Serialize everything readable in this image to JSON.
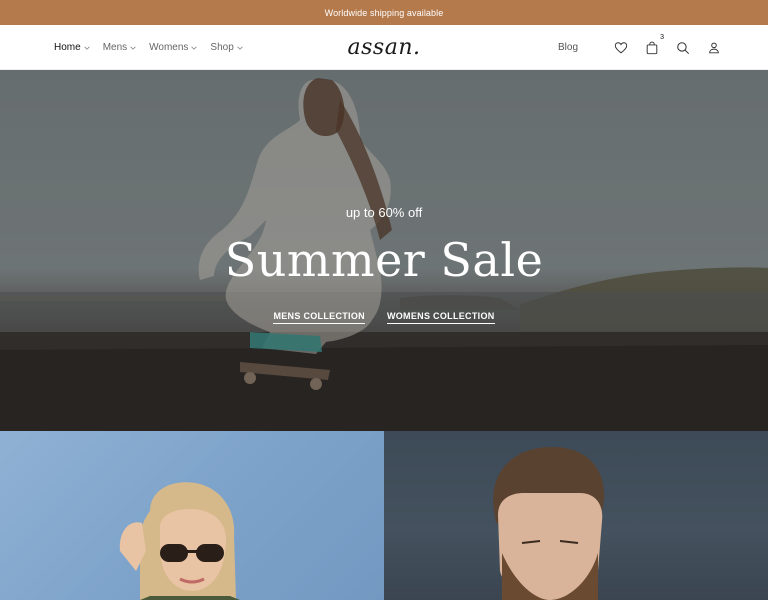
{
  "topbar": {
    "text": "Worldwide shipping available"
  },
  "header": {
    "logo": "assan.",
    "nav": [
      {
        "label": "Home",
        "active": true
      },
      {
        "label": "Mens",
        "active": false
      },
      {
        "label": "Womens",
        "active": false
      },
      {
        "label": "Shop",
        "active": false
      }
    ],
    "blog_label": "Blog",
    "cart_count": "3",
    "icons": [
      "heart-icon",
      "shopping-bag-icon",
      "search-icon",
      "user-icon"
    ]
  },
  "hero": {
    "subtitle": "up to 60% off",
    "title": "Summer Sale",
    "links": [
      "MENS COLLECTION",
      "WOMENS COLLECTION"
    ]
  },
  "colors": {
    "topbar": "#b57a4c",
    "text": "#222222"
  }
}
